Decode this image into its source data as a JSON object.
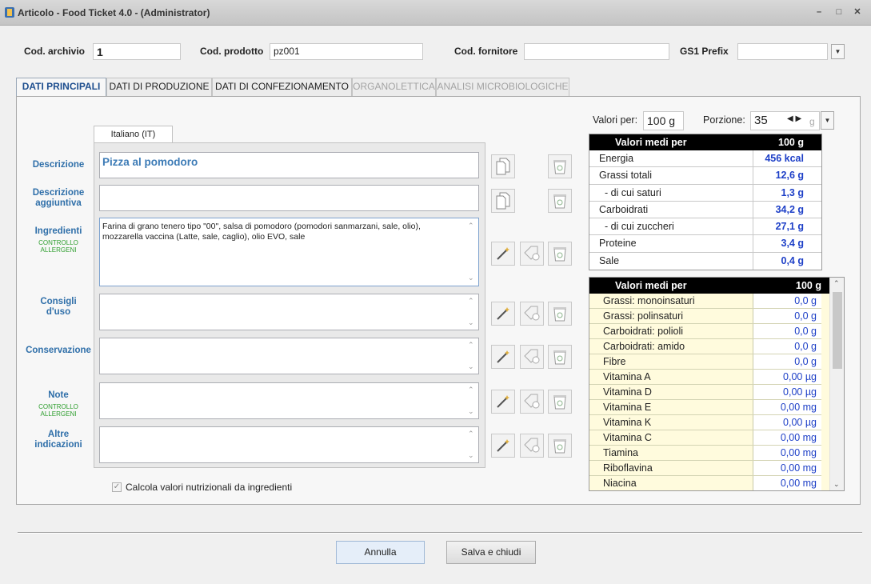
{
  "window": {
    "title": "Articolo - Food Ticket 4.0 - (Administrator)"
  },
  "header": {
    "cod_archivio_label": "Cod. archivio",
    "cod_archivio_value": "1",
    "cod_prodotto_label": "Cod. prodotto",
    "cod_prodotto_value": "pz001",
    "cod_fornitore_label": "Cod. fornitore",
    "cod_fornitore_value": "",
    "gs1_label": "GS1 Prefix",
    "gs1_value": ""
  },
  "tabs": [
    {
      "label": "DATI PRINCIPALI",
      "state": "active"
    },
    {
      "label": "DATI DI PRODUZIONE",
      "state": "normal"
    },
    {
      "label": "DATI DI CONFEZIONAMENTO",
      "state": "normal"
    },
    {
      "label": "ORGANOLETTICA",
      "state": "disabled"
    },
    {
      "label": "ANALISI MICROBIOLOGICHE",
      "state": "disabled"
    }
  ],
  "language_tab": "Italiano (IT)",
  "fields": {
    "descrizione": {
      "label": "Descrizione",
      "value": "Pizza al pomodoro"
    },
    "descrizione_aggiuntiva": {
      "label_line1": "Descrizione",
      "label_line2": "aggiuntiva",
      "value": ""
    },
    "ingredienti": {
      "label": "Ingredienti",
      "sub1": "CONTROLLO",
      "sub2": "ALLERGENI",
      "value": "Farina di grano tenero tipo \"00\", salsa di pomodoro (pomodori sanmarzani, sale, olio), mozzarella vaccina (Latte, sale, caglio), olio EVO, sale"
    },
    "consigli": {
      "label_line1": "Consigli",
      "label_line2": "d'uso",
      "value": ""
    },
    "conservazione": {
      "label": "Conservazione",
      "value": ""
    },
    "note": {
      "label": "Note",
      "sub1": "CONTROLLO",
      "sub2": "ALLERGENI",
      "value": ""
    },
    "altre": {
      "label_line1": "Altre",
      "label_line2": "indicazioni",
      "value": ""
    }
  },
  "checkbox": {
    "label": "Calcola valori nutrizionali da ingredienti",
    "checked": true
  },
  "valori": {
    "per_label": "Valori per:",
    "per_value": "100 g",
    "porzione_label": "Porzione:",
    "porzione_value": "35",
    "porzione_unit": "g"
  },
  "nutrition_main": {
    "header_name": "Valori medi per",
    "header_value": "100 g",
    "rows": [
      {
        "name": "Energia",
        "value": "456 kcal"
      },
      {
        "name": "Grassi totali",
        "value": "12,6 g"
      },
      {
        "name": "  - di cui saturi",
        "value": "1,3 g"
      },
      {
        "name": "Carboidrati",
        "value": "34,2 g"
      },
      {
        "name": "  - di cui zuccheri",
        "value": "27,1 g"
      },
      {
        "name": "Proteine",
        "value": "3,4 g"
      },
      {
        "name": "Sale",
        "value": "0,4 g"
      }
    ]
  },
  "nutrition_extra": {
    "header_name": "Valori medi per",
    "header_value": "100 g",
    "rows": [
      {
        "name": "Grassi: monoinsaturi",
        "value": "0,0 g"
      },
      {
        "name": "Grassi: polinsaturi",
        "value": "0,0 g"
      },
      {
        "name": "Carboidrati: polioli",
        "value": "0,0 g"
      },
      {
        "name": "Carboidrati: amido",
        "value": "0,0 g"
      },
      {
        "name": "Fibre",
        "value": "0,0 g"
      },
      {
        "name": "Vitamina A",
        "value": "0,00 µg"
      },
      {
        "name": "Vitamina D",
        "value": "0,00 µg"
      },
      {
        "name": "Vitamina E",
        "value": "0,00 mg"
      },
      {
        "name": "Vitamina K",
        "value": "0,00 µg"
      },
      {
        "name": "Vitamina C",
        "value": "0,00 mg"
      },
      {
        "name": "Tiamina",
        "value": "0,00 mg"
      },
      {
        "name": "Riboflavina",
        "value": "0,00 mg"
      },
      {
        "name": "Niacina",
        "value": "0,00 mg"
      }
    ]
  },
  "buttons": {
    "cancel": "Annulla",
    "save": "Salva e chiudi"
  },
  "colors": {
    "label_blue": "#2f6fa9",
    "value_blue": "#1d3fc7",
    "allergeni_green": "#2e9e2e",
    "extra_bg": "#fffbdd"
  }
}
